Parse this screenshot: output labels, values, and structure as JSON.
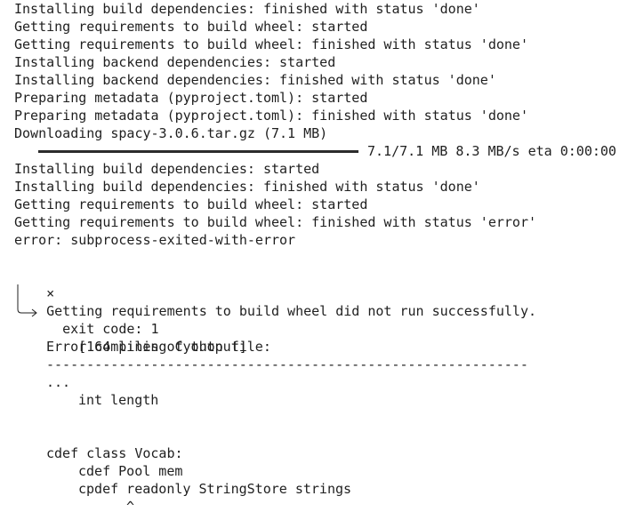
{
  "log": {
    "lines_before": [
      "Installing build dependencies: finished with status 'done'",
      "Getting requirements to build wheel: started",
      "Getting requirements to build wheel: finished with status 'done'",
      "Installing backend dependencies: started",
      "Installing backend dependencies: finished with status 'done'",
      "Preparing metadata (pyproject.toml): started",
      "Preparing metadata (pyproject.toml): finished with status 'done'",
      "Downloading spacy-3.0.6.tar.gz (7.1 MB)"
    ],
    "progress": {
      "fraction": 1.0,
      "text": "7.1/7.1 MB 8.3 MB/s eta 0:00:00"
    },
    "lines_after": [
      "Installing build dependencies: started",
      "Installing build dependencies: finished with status 'done'",
      "Getting requirements to build wheel: started",
      "Getting requirements to build wheel: finished with status 'error'",
      "error: subprocess-exited-with-error"
    ],
    "error_block": {
      "marker": "×",
      "summary": "Getting requirements to build wheel did not run successfully.",
      "exit_code": "exit code: 1",
      "output_note": "[164 lines of output]"
    },
    "cython": {
      "title": "Error compiling Cython file:",
      "rule": "------------------------------------------------------------",
      "ellipsis": "...",
      "int_length": "int length",
      "class_decl": "cdef class Vocab:",
      "pool_mem": "cdef Pool mem",
      "strings": "cpdef readonly StringStore strings",
      "caret": "^"
    }
  },
  "colors": {
    "text": "#1f1f1f",
    "background": "#ffffff",
    "progress": "#2b2b2b"
  }
}
